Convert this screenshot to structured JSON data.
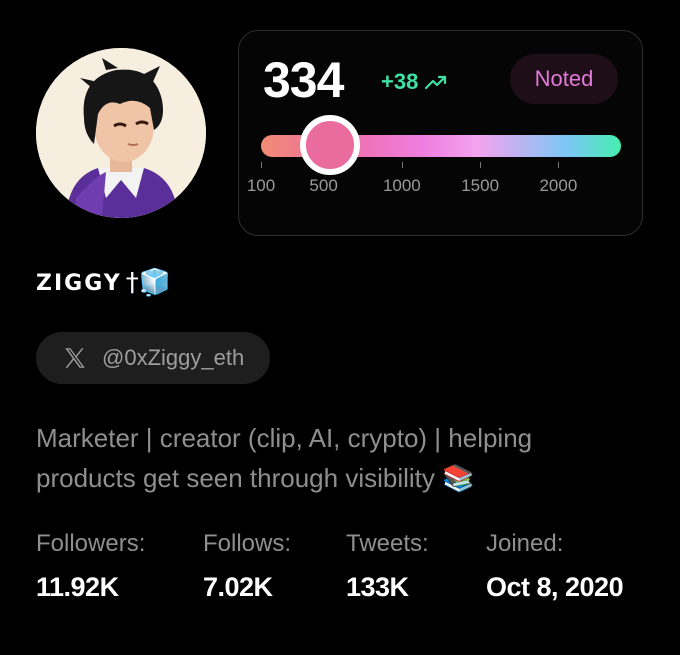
{
  "profile": {
    "display_name": "ZIGGY",
    "name_emojis": "†🧊",
    "handle": "@0xZiggy_eth",
    "bio": "Marketer | creator (clip, AI, crypto) | helping products get seen through visibility 📚",
    "avatar_icon": "anime-portrait-avatar",
    "platform_icon": "x-logo-icon"
  },
  "score_card": {
    "score": "334",
    "delta": "+38",
    "trend_icon": "trend-up-icon",
    "badge": "Noted",
    "slider": {
      "min": 100,
      "max": 2400,
      "value": 540,
      "ticks": [
        "100",
        "500",
        "1000",
        "1500",
        "2000"
      ]
    }
  },
  "stats": [
    {
      "label": "Followers:",
      "value": "11.92K"
    },
    {
      "label": "Follows:",
      "value": "7.02K"
    },
    {
      "label": "Tweets:",
      "value": "133K"
    },
    {
      "label": "Joined:",
      "value": "Oct 8, 2020"
    }
  ],
  "colors": {
    "background": "#000000",
    "accent_green": "#3ee0a4",
    "badge_text": "#e27ad9",
    "thumb": "#ea6b9e",
    "muted_text": "#8f8f8f"
  }
}
